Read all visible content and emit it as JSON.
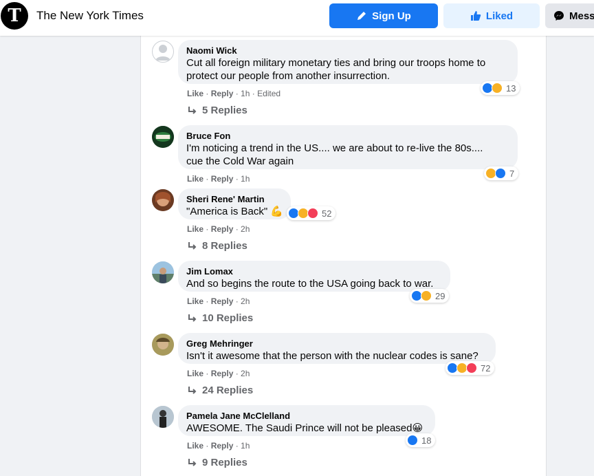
{
  "header": {
    "page_name": "The New York Times",
    "logo_glyph": "T",
    "sign_up_label": "Sign Up",
    "liked_label": "Liked",
    "message_label": "Mess",
    "accent_color": "#1877f2"
  },
  "comments": [
    {
      "author": "Naomi Wick",
      "text_lines": [
        "Cut all foreign military monetary ties and bring our troops home to",
        "protect our people from another insurrection."
      ],
      "actions": {
        "like": "Like",
        "reply": "Reply",
        "time": "1h",
        "edited": "Edited"
      },
      "reactions": {
        "types": [
          "like",
          "haha"
        ],
        "count": "13"
      },
      "replies": "5 Replies"
    },
    {
      "author": "Bruce Fon",
      "text_lines": [
        "I'm noticing a trend in the US.... we are about to re-live the 80s....",
        "cue the Cold War again"
      ],
      "actions": {
        "like": "Like",
        "reply": "Reply",
        "time": "1h"
      },
      "reactions": {
        "types": [
          "haha",
          "like"
        ],
        "count": "7"
      },
      "replies": ""
    },
    {
      "author": "Sheri Rene' Martin",
      "text_lines": [
        "\"America is Back\" 💪"
      ],
      "actions": {
        "like": "Like",
        "reply": "Reply",
        "time": "2h"
      },
      "reactions": {
        "types": [
          "like",
          "haha",
          "love"
        ],
        "count": "52"
      },
      "replies": "8 Replies"
    },
    {
      "author": "Jim Lomax",
      "text_lines": [
        "And so begins the route to the USA going back to war."
      ],
      "actions": {
        "like": "Like",
        "reply": "Reply",
        "time": "2h"
      },
      "reactions": {
        "types": [
          "like",
          "haha"
        ],
        "count": "29"
      },
      "replies": "10 Replies"
    },
    {
      "author": "Greg Mehringer",
      "text_lines": [
        "Isn't it awesome that the person with the nuclear codes is sane?"
      ],
      "actions": {
        "like": "Like",
        "reply": "Reply",
        "time": "2h"
      },
      "reactions": {
        "types": [
          "like",
          "haha",
          "love"
        ],
        "count": "72"
      },
      "replies": "24 Replies"
    },
    {
      "author": "Pamela Jane McClelland",
      "text_lines": [
        "AWESOME. The Saudi Prince will not be pleased😀"
      ],
      "actions": {
        "like": "Like",
        "reply": "Reply",
        "time": "1h"
      },
      "reactions": {
        "types": [
          "like"
        ],
        "count": "18"
      },
      "replies": "9 Replies"
    }
  ]
}
